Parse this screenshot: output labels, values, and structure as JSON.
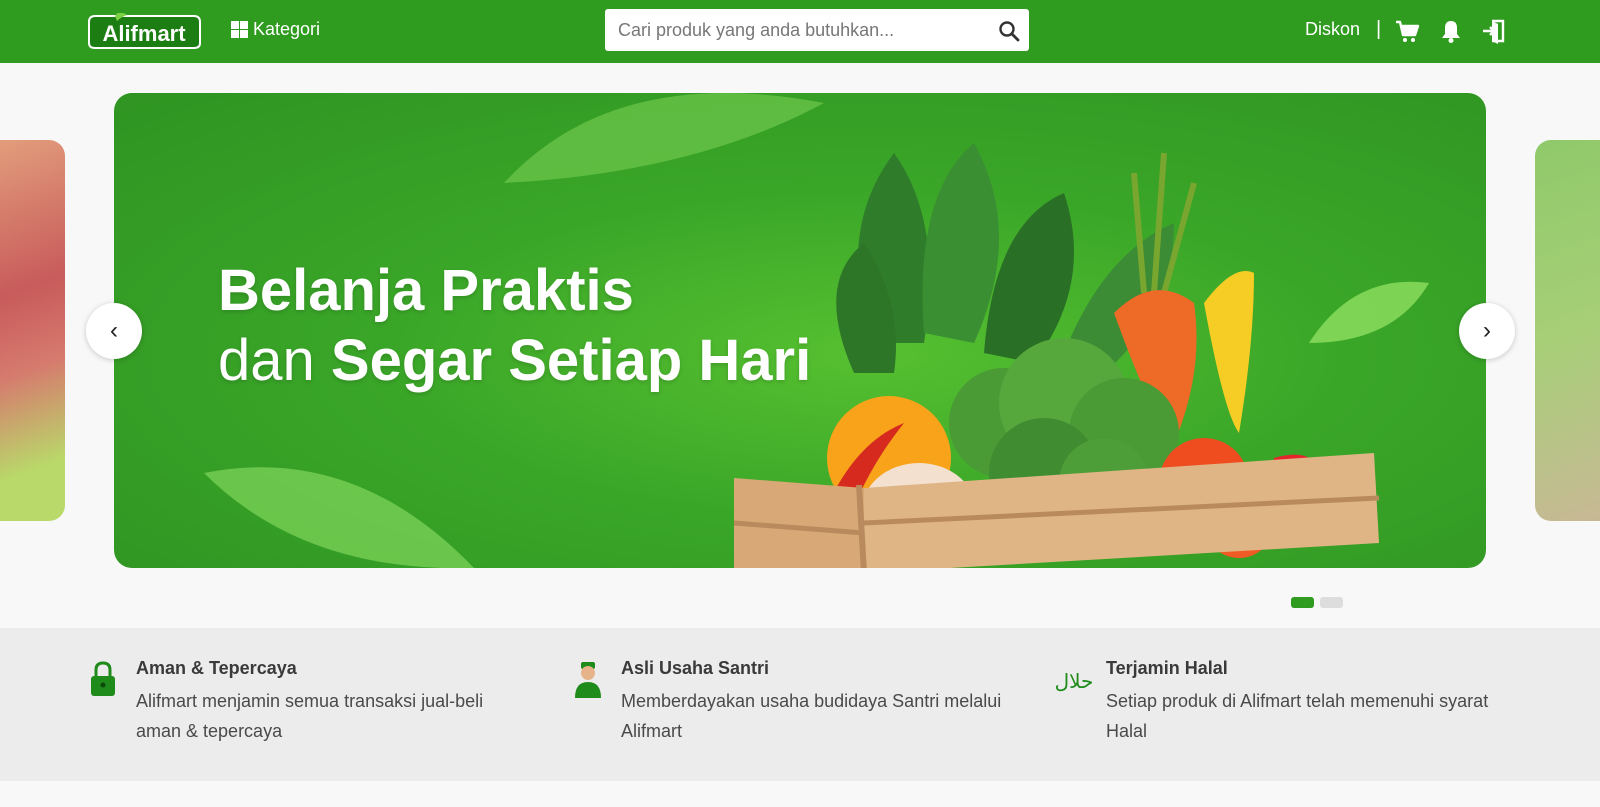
{
  "header": {
    "logo_text": "Alifmart",
    "kategori_label": "Kategori",
    "search": {
      "placeholder": "Cari produk yang anda butuhkan..."
    },
    "diskon_label": "Diskon",
    "separator": "|",
    "icons": [
      "cart-icon",
      "bell-icon",
      "login-icon"
    ]
  },
  "banner": {
    "line1": "Belanja Praktis",
    "line2_light": "dan",
    "line2_bold": "Segar Setiap Hari",
    "prev_label": "‹",
    "next_label": "›",
    "slides_count": 2,
    "active_slide": 1
  },
  "features": [
    {
      "icon": "lock-icon",
      "title": "Aman & Tepercaya",
      "desc": "Alifmart menjamin semua transaksi jual-beli aman & tepercaya"
    },
    {
      "icon": "santri-icon",
      "title": "Asli Usaha Santri",
      "desc": "Memberdayakan usaha budidaya Santri melalui Alifmart"
    },
    {
      "icon": "halal-icon",
      "title": "Terjamin Halal",
      "desc": "Setiap produk di Alifmart telah memenuhi syarat Halal",
      "icon_text": "حلال"
    }
  ],
  "colors": {
    "brand": "#2f9b1f",
    "feature_bg": "#ececec",
    "page_bg": "#f8f8f8"
  }
}
